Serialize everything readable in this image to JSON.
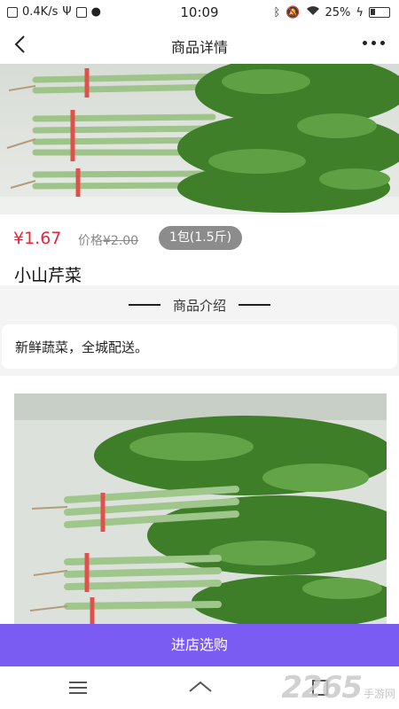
{
  "status_bar": {
    "speed": "0.4K/s",
    "time": "10:09",
    "battery": "25%"
  },
  "nav": {
    "title": "商品详情"
  },
  "product": {
    "price": "¥1.67",
    "old_price_label": "价格",
    "old_price": "¥2.00",
    "unit": "1包(1.5斤)",
    "name": "小山芹菜"
  },
  "section": {
    "title": "商品介绍"
  },
  "intro": {
    "text": "新鲜蔬菜，全城配送。"
  },
  "cta": {
    "label": "进店选购"
  },
  "watermark": {
    "big": "2265",
    "small": "手游网"
  },
  "colors": {
    "accent": "#7b5cf2",
    "price": "#e8253a"
  }
}
